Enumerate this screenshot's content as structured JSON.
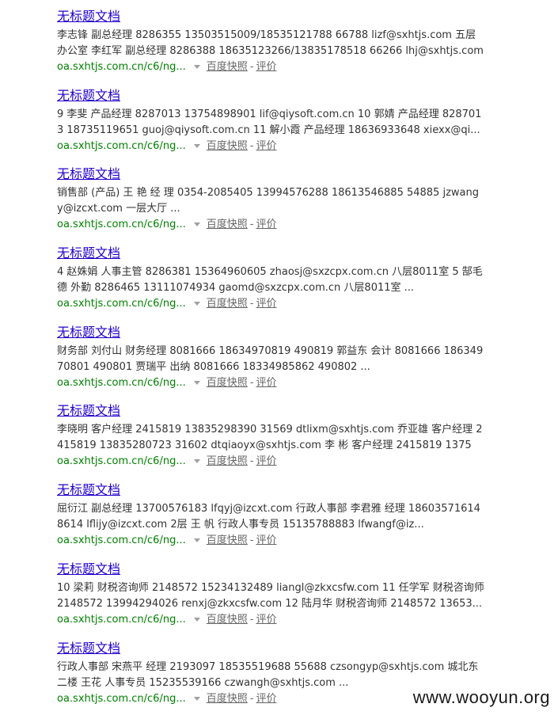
{
  "results": [
    {
      "title": "无标题文档",
      "snippet": "李志锋 副总经理 8286355 13503515009/18535121788 66788 lizf@sxhtjs.com 五层办公室 李红军 副总经理 8286388 18635123266/13835178518 66266 lhj@sxhtjs.com 五层办公...",
      "url": "oa.sxhtjs.com.cn/c6/ng...",
      "cache": "百度快照",
      "rate": "评价"
    },
    {
      "title": "无标题文档",
      "snippet": "9 李斐 产品经理 8287013 13754898901 lif@qiysoft.com.cn 10 郭婧 产品经理 8287013 18735119651 guoj@qiysoft.com.cn 11 解小霞 产品经理 18636933648 xiexx@qi...",
      "url": "oa.sxhtjs.com.cn/c6/ng...",
      "cache": "百度快照",
      "rate": "评价"
    },
    {
      "title": "无标题文档",
      "snippet": "销售部 (产品) 王 艳 经 理 0354-2085405 13994576288 18613546885 54885 jzwangy@izcxt.com 一层大厅 ...",
      "url": "oa.sxhtjs.com.cn/c6/ng...",
      "cache": "百度快照",
      "rate": "评价"
    },
    {
      "title": "无标题文档",
      "snippet": "4 赵姝娟 人事主管 8286381 15364960605 zhaosj@sxzcpx.com.cn 八层8011室 5 郜毛德 外勤 8286465 13111074934 gaomd@sxzcpx.com.cn 八层8011室 ...",
      "url": "oa.sxhtjs.com.cn/c6/ng...",
      "cache": "百度快照",
      "rate": "评价"
    },
    {
      "title": "无标题文档",
      "snippet": "财务部 刘付山 财务经理 8081666 18634970819 490819 郭益东 会计 8081666 18634970801 490801 贾瑞平 出纳 8081666 18334985862 490802 ...",
      "url": "oa.sxhtjs.com.cn/c6/ng...",
      "cache": "百度快照",
      "rate": "评价"
    },
    {
      "title": "无标题文档",
      "snippet": "李晓明 客户经理 2415819 13835298390 31569 dtlixm@sxhtjs.com 乔亚雄 客户经理 2415819 13835280723 31602 dtqiaoyx@sxhtjs.com 李 彬 客户经理 2415819 13753...",
      "url": "oa.sxhtjs.com.cn/c6/ng...",
      "cache": "百度快照",
      "rate": "评价"
    },
    {
      "title": "无标题文档",
      "snippet": "屈衍江 副总经理 13700576183 lfqyj@izcxt.com 行政人事部 李君雅 经理 18603571614 8614 lflijy@izcxt.com 2层 王 帆 行政人事专员 15135788883 lfwangf@iz...",
      "url": "oa.sxhtjs.com.cn/c6/ng...",
      "cache": "百度快照",
      "rate": "评价"
    },
    {
      "title": "无标题文档",
      "snippet": "10 梁莉 财税咨询师 2148572 15234132489 liangl@zkxcsfw.com 11 任学军 财税咨询师 2148572 13994294026 renxj@zkxcsfw.com 12 陆月华 财税咨询师 2148572 13653...",
      "url": "oa.sxhtjs.com.cn/c6/ng...",
      "cache": "百度快照",
      "rate": "评价"
    },
    {
      "title": "无标题文档",
      "snippet": "行政人事部 宋燕平 经理 2193097 18535519688 55688 czsongyp@sxhtjs.com 城北东二楼 王花 人事专员 15235539166 czwangh@sxhtjs.com ...",
      "url": "oa.sxhtjs.com.cn/c6/ng...",
      "cache": "百度快照",
      "rate": "评价"
    }
  ],
  "separator": "-",
  "icons": {
    "dropdown": "caret-down-icon"
  },
  "colors": {
    "title": "#2200cc",
    "url": "#008000",
    "snippet": "#333333",
    "meta_link": "#666666"
  },
  "watermark": "www.wooyun.org"
}
